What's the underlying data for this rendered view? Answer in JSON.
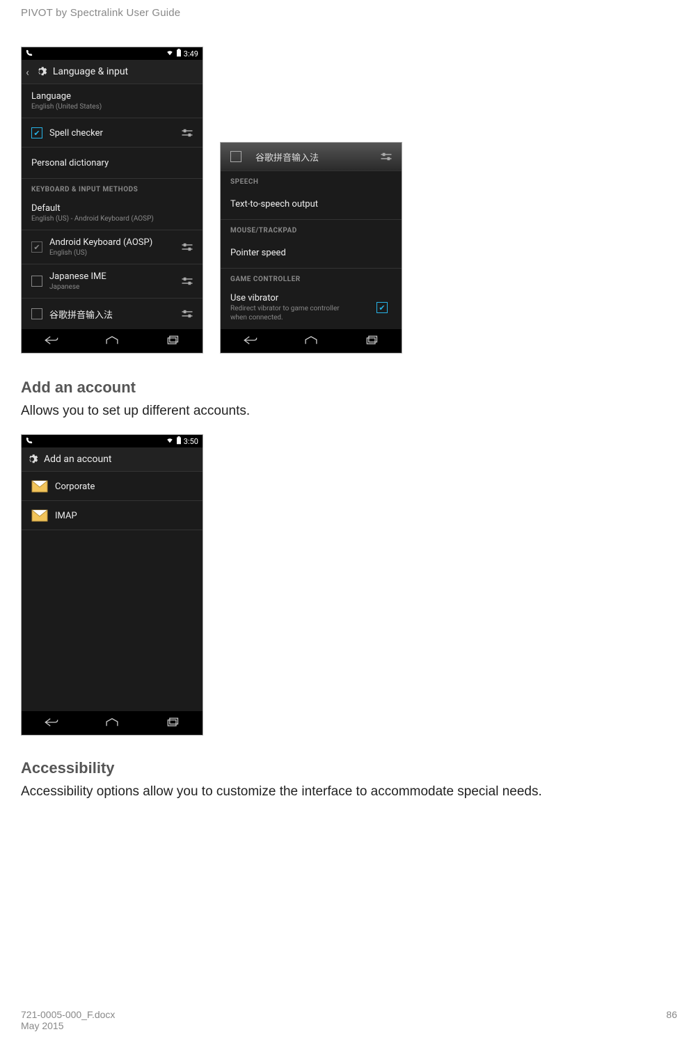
{
  "doc_header": "PIVOT by Spectralink User Guide",
  "phone1": {
    "time": "3:49",
    "header_title": "Language & input",
    "language_row": {
      "title": "Language",
      "sub": "English (United States)"
    },
    "spell_checker": "Spell checker",
    "personal_dict": "Personal dictionary",
    "section_keyboard": "KEYBOARD & INPUT METHODS",
    "default_row": {
      "title": "Default",
      "sub": "English (US) - Android Keyboard (AOSP)"
    },
    "aosp_row": {
      "title": "Android Keyboard (AOSP)",
      "sub": "English (US)"
    },
    "jp_row": {
      "title": "Japanese IME",
      "sub": "Japanese"
    },
    "cn_row": {
      "title": "谷歌拼音输入法"
    }
  },
  "phone2": {
    "top_row": "谷歌拼音输入法",
    "section_speech": "SPEECH",
    "tts": "Text-to-speech output",
    "section_mouse": "MOUSE/TRACKPAD",
    "pointer": "Pointer speed",
    "section_game": "GAME CONTROLLER",
    "vibrator_row": {
      "title": "Use vibrator",
      "sub": "Redirect vibrator to game controller when connected."
    }
  },
  "add_account": {
    "heading": "Add an account",
    "body": "Allows you to set up different accounts.",
    "time": "3:50",
    "header_title": "Add an account",
    "items": [
      "Corporate",
      "IMAP"
    ]
  },
  "accessibility": {
    "heading": "Accessibility",
    "body": "Accessibility options allow you to customize the interface to accommodate special needs."
  },
  "footer": {
    "filename": "721-0005-000_F.docx",
    "date": "May 2015",
    "page": "86"
  }
}
